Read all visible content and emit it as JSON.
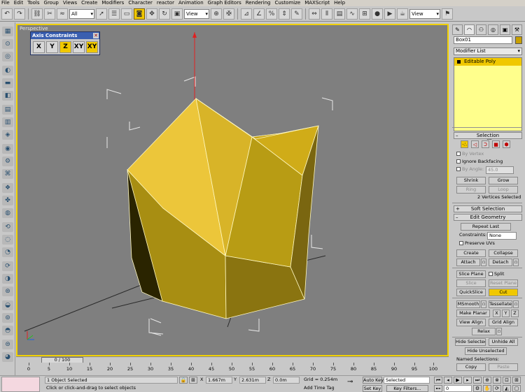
{
  "menu": [
    "File",
    "Edit",
    "Tools",
    "Group",
    "Views",
    "Create",
    "Modifiers",
    "Character",
    "reactor",
    "Animation",
    "Graph Editors",
    "Rendering",
    "Customize",
    "MAXScript",
    "Help"
  ],
  "toolbar": {
    "selection_filter": "All",
    "ref_coord": "View",
    "named_sel": "View"
  },
  "viewport": {
    "label": "Perspective",
    "object_color": "#e8c020"
  },
  "axis_constraints": {
    "title": "Axis Constraints",
    "buttons": [
      "X",
      "Y",
      "Z",
      "XY",
      "XY"
    ],
    "active_index": 4
  },
  "command_panel": {
    "object_name": "Box01",
    "modifier_list": "Modifier List",
    "stack_item": "Editable Poly",
    "selection": {
      "title": "Selection",
      "by_vertex": "By Vertex",
      "ignore_backfacing": "Ignore Backfacing",
      "by_angle": "By Angle:",
      "angle_value": "45.0",
      "shrink": "Shrink",
      "grow": "Grow",
      "ring": "Ring",
      "loop": "Loop",
      "status": "2 Vertices Selected"
    },
    "soft_selection": {
      "title": "Soft Selection"
    },
    "edit_geometry": {
      "title": "Edit Geometry",
      "repeat_last": "Repeat Last",
      "constraints_label": "Constraints:",
      "constraints_value": "None",
      "preserve_uvs": "Preserve UVs",
      "create": "Create",
      "collapse": "Collapse",
      "attach": "Attach",
      "detach": "Detach",
      "slice_plane": "Slice Plane",
      "split": "Split",
      "slice": "Slice",
      "reset_plane": "Reset Plane",
      "quickslice": "QuickSlice",
      "cut": "Cut",
      "msmooth": "MSmooth",
      "tessellate": "Tessellate",
      "make_planar": "Make Planar",
      "x": "X",
      "y": "Y",
      "z": "Z",
      "view_align": "View Align",
      "grid_align": "Grid Align",
      "relax": "Relax",
      "hide_selected": "Hide Selected",
      "unhide_all": "Unhide All",
      "hide_unselected": "Hide Unselected",
      "named_selections": "Named Selections:",
      "copy": "Copy",
      "paste": "Paste"
    }
  },
  "timeline": {
    "thumb": "0 / 100",
    "ticks": [
      "0",
      "5",
      "10",
      "15",
      "20",
      "25",
      "30",
      "35",
      "40",
      "45",
      "50",
      "55",
      "60",
      "65",
      "70",
      "75",
      "80",
      "85",
      "90",
      "95",
      "100"
    ]
  },
  "status": {
    "selected": "1 Object Selected",
    "prompt": "Click or click-and-drag to select objects",
    "x_label": "X",
    "x_value": "1.667m",
    "y_label": "Y",
    "y_value": "2.631m",
    "z_label": "Z",
    "z_value": "0.0m",
    "grid": "Grid = 0.254m",
    "add_time_tag": "Add Time Tag",
    "auto_key": "Auto Key",
    "auto_key_value": "Selected",
    "set_key": "Set Key",
    "key_filters": "Key Filters...",
    "frame": "0"
  }
}
